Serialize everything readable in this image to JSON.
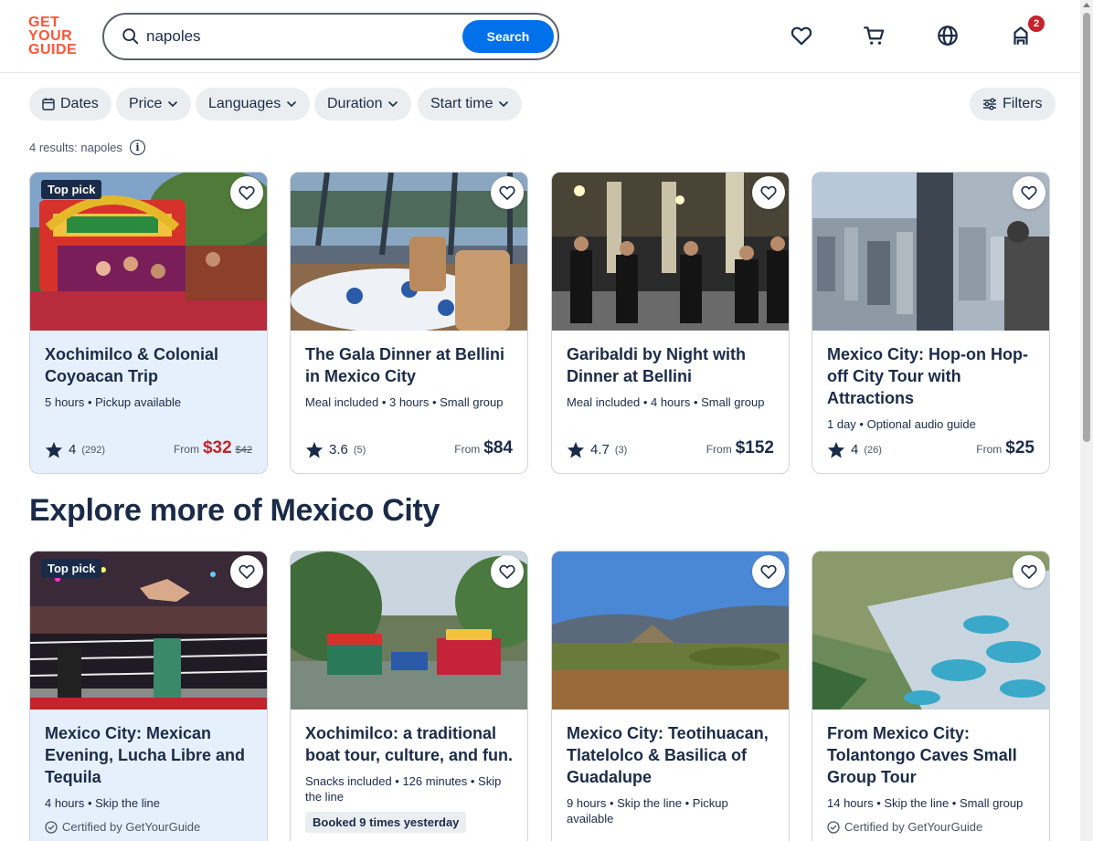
{
  "logo": {
    "line1": "GET",
    "line2": "YOUR",
    "line3": "GUIDE"
  },
  "search": {
    "value": "napoles",
    "button_label": "Search"
  },
  "header": {
    "cart_count": "2"
  },
  "filters": [
    {
      "label": "Dates"
    },
    {
      "label": "Price"
    },
    {
      "label": "Languages"
    },
    {
      "label": "Duration"
    },
    {
      "label": "Start time"
    }
  ],
  "filters_button": "Filters",
  "results_text": "4 results: napoles",
  "cards": [
    {
      "title": "Xochimilco & Colonial Coyoacan Trip",
      "meta": "5 hours • Pickup available",
      "badge": "Top pick",
      "rating": "4",
      "reviews": "(292)",
      "from": "From",
      "price": "$32",
      "old_price": "$42"
    },
    {
      "title": "The Gala Dinner at Bellini in Mexico City",
      "meta": "Meal included • 3 hours • Small group",
      "rating": "3.6",
      "reviews": "(5)",
      "from": "From",
      "price": "$84"
    },
    {
      "title": "Garibaldi by Night with Dinner at Bellini",
      "meta": "Meal included • 4 hours • Small group",
      "rating": "4.7",
      "reviews": "(3)",
      "from": "From",
      "price": "$152"
    },
    {
      "title": "Mexico City: Hop-on Hop-off City Tour with Attractions",
      "meta": "1 day • Optional audio guide",
      "rating": "4",
      "reviews": "(26)",
      "from": "From",
      "price": "$25"
    }
  ],
  "section_title": "Explore more of Mexico City",
  "explore": [
    {
      "title": "Mexico City: Mexican Evening, Lucha Libre and Tequila",
      "meta": "4 hours • Skip the line",
      "badge": "Top pick",
      "certified": "Certified by GetYourGuide"
    },
    {
      "title": "Xochimilco: a traditional boat tour, culture, and fun.",
      "meta": "Snacks included • 126 minutes • Skip the line",
      "booked": "Booked 9 times yesterday"
    },
    {
      "title": "Mexico City: Teotihuacan, Tlatelolco & Basilica of Guadalupe",
      "meta": "9 hours • Skip the line • Pickup available"
    },
    {
      "title": "From Mexico City: Tolantongo Caves Small Group Tour",
      "meta": "14 hours • Skip the line • Small group",
      "certified": "Certified by GetYourGuide"
    }
  ],
  "colors": {
    "brand": "#ff5533",
    "primary": "#0071eb",
    "sale": "#c4232b",
    "navy": "#1a2b49"
  }
}
